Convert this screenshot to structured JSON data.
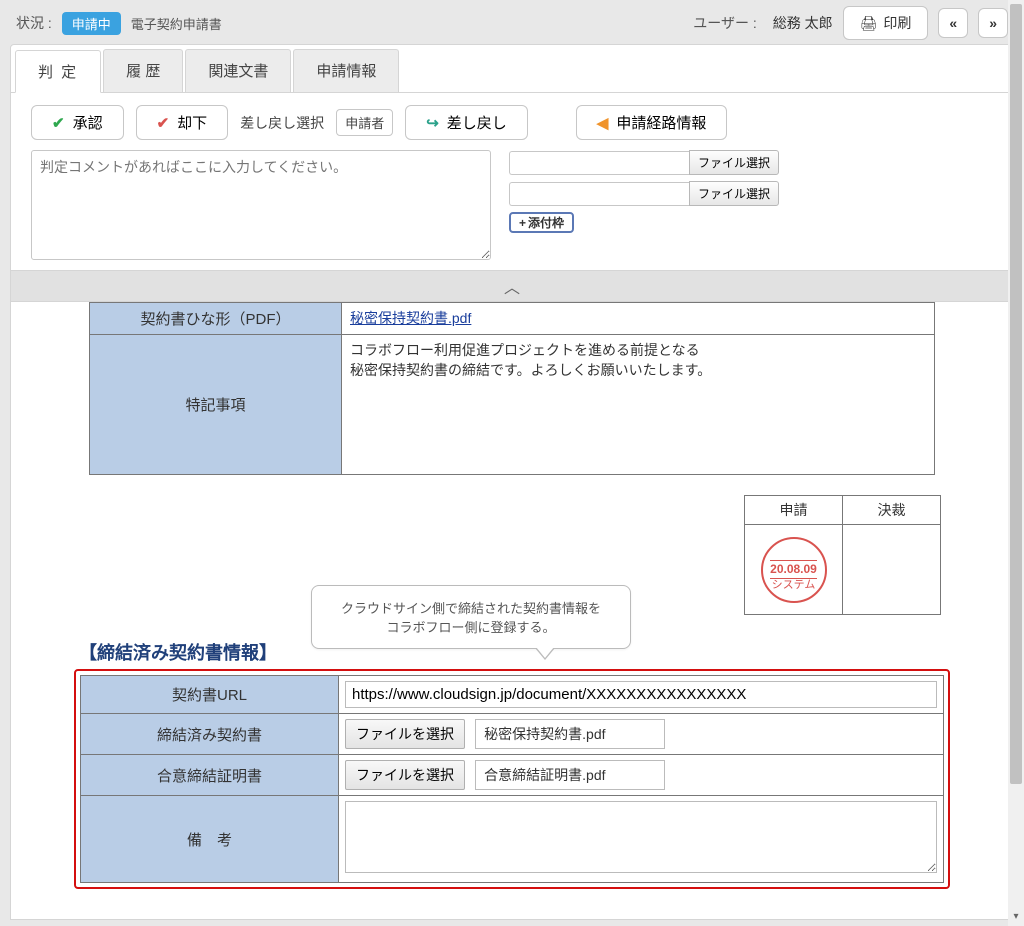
{
  "header": {
    "status_label": "状況 :",
    "status_badge": "申請中",
    "doc_type": "電子契約申請書",
    "user_label": "ユーザー :",
    "user_name": "総務 太郎",
    "print": "印刷",
    "prev": "«",
    "next": "»"
  },
  "tabs": {
    "judge": "判 定",
    "history": "履 歴",
    "related": "関連文書",
    "appinfo": "申請情報"
  },
  "actions": {
    "approve": "承認",
    "reject": "却下",
    "return_label": "差し戻し選択",
    "return_target": "申請者",
    "return_btn": "差し戻し",
    "route_info": "申請経路情報"
  },
  "comment_placeholder": "判定コメントがあればここに入力してください。",
  "file": {
    "pick": "ファイル選択",
    "add_attach": "添付枠"
  },
  "upper_table": {
    "template_label": "契約書ひな形（PDF）",
    "template_link": "秘密保持契約書.pdf",
    "notes_label": "特記事項",
    "notes_body_1": "コラボフロー利用促進プロジェクトを進める前提となる",
    "notes_body_2": "秘密保持契約書の締結です。よろしくお願いいたします。"
  },
  "stamps": {
    "apply": "申請",
    "decide": "決裁",
    "date": "20.08.09",
    "name": "システム"
  },
  "callout": {
    "line1": "クラウドサイン側で締結された契約書情報を",
    "line2": "コラボフロー側に登録する。"
  },
  "section_heading": "【締結済み契約書情報】",
  "info": {
    "url_label": "契約書URL",
    "url_value": "https://www.cloudsign.jp/document/XXXXXXXXXXXXXXXX",
    "signed_label": "締結済み契約書",
    "signed_file": "秘密保持契約書.pdf",
    "cert_label": "合意締結証明書",
    "cert_file": "合意締結証明書.pdf",
    "file_select": "ファイルを選択",
    "remarks_label": "備　考",
    "remarks_value": ""
  }
}
